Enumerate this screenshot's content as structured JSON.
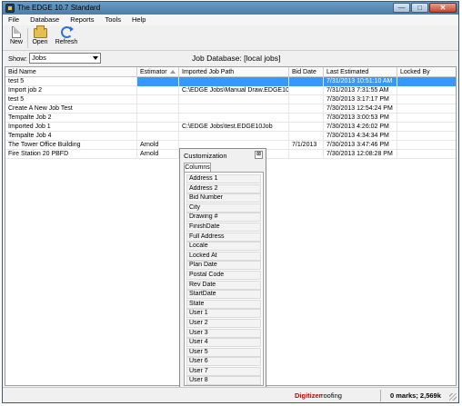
{
  "window": {
    "title": "The EDGE 10.7 Standard"
  },
  "menu": [
    "File",
    "Database",
    "Reports",
    "Tools",
    "Help"
  ],
  "toolbar": {
    "new_label": "New",
    "open_label": "Open",
    "refresh_label": "Refresh"
  },
  "show": {
    "label": "Show:",
    "value": "Jobs"
  },
  "database_title": "Job Database: [local jobs]",
  "grid": {
    "columns": [
      "Bid Name",
      "Estimator",
      "Imported Job Path",
      "Bid Date",
      "Last Estimated",
      "Locked By"
    ],
    "rows": [
      [
        "test 5",
        "",
        "",
        "",
        "7/31/2013 10:51:10 AM",
        ""
      ],
      [
        "Import job 2",
        "",
        "C:\\EDGE Jobs\\Manual Draw.EDGE10Job",
        "",
        "7/31/2013 7:31:55 AM",
        ""
      ],
      [
        "test 5",
        "",
        "",
        "",
        "7/30/2013 3:17:17 PM",
        ""
      ],
      [
        "Create A New Job Test",
        "",
        "",
        "",
        "7/30/2013 12:54:24 PM",
        ""
      ],
      [
        "Tempalte Job 2",
        "",
        "",
        "",
        "7/30/2013 3:00:53 PM",
        ""
      ],
      [
        "Imported Job 1",
        "",
        "C:\\EDGE Jobs\\test.EDGE10Job",
        "",
        "7/30/2013 4:26:02 PM",
        ""
      ],
      [
        "Tempalte Job 4",
        "",
        "",
        "",
        "7/30/2013 4:34:34 PM",
        ""
      ],
      [
        "The Tower Office Building",
        "Arnold",
        "",
        "7/1/2013",
        "7/30/2013 3:47:46 PM",
        ""
      ],
      [
        "Fire Station 20 PBFD",
        "Arnold",
        "",
        "",
        "7/30/2013 12:08:28 PM",
        ""
      ]
    ]
  },
  "customization": {
    "title": "Customization",
    "close_label": "⊠",
    "tab_label": "Columns",
    "fields": [
      "Address 1",
      "Address 2",
      "Bid Number",
      "City",
      "Drawing #",
      "FinishDate",
      "Full Address",
      "Locale",
      "Locked At",
      "Plan Date",
      "Postal Code",
      "Rev Date",
      "StartDate",
      "State",
      "User 1",
      "User 2",
      "User 3",
      "User 4",
      "User 5",
      "User 6",
      "User 7",
      "User 8"
    ]
  },
  "status": {
    "mode": "Digitizer",
    "profile": "roofing",
    "marks": "0 marks; 2,569k"
  },
  "colors": {
    "selection": "#3399ff",
    "digitizer": "#cc0000",
    "titlebar": "#5b8db8"
  }
}
